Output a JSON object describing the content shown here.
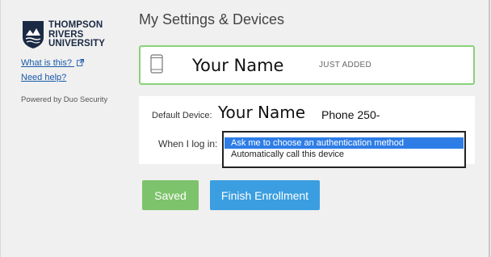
{
  "sidebar": {
    "logo_lines": [
      "THOMPSON",
      "RIVERS",
      "UNIVERSITY"
    ],
    "whats_this_link": "What is this?",
    "help_link": "Need help?",
    "powered_by": "Powered by Duo Security"
  },
  "main": {
    "title": "My Settings & Devices",
    "device": {
      "icon": "phone-icon",
      "name": "Your Name",
      "status": "JUST ADDED"
    },
    "settings": {
      "default_device_label": "Default Device:",
      "default_device_name": "Your Name",
      "default_device_phone": "Phone 250-",
      "login_label": "When I log in:",
      "options": [
        "Ask me to choose an authentication method",
        "Automatically call this device"
      ],
      "selected_option": "Ask me to choose an authentication method"
    },
    "buttons": {
      "saved": "Saved",
      "finish": "Finish Enrollment"
    }
  },
  "colors": {
    "accent_blue": "#3a9ee0",
    "success_green": "#7dc36b",
    "card_border_green": "#8ad17a",
    "selected_option_bg": "#2e7de6"
  }
}
